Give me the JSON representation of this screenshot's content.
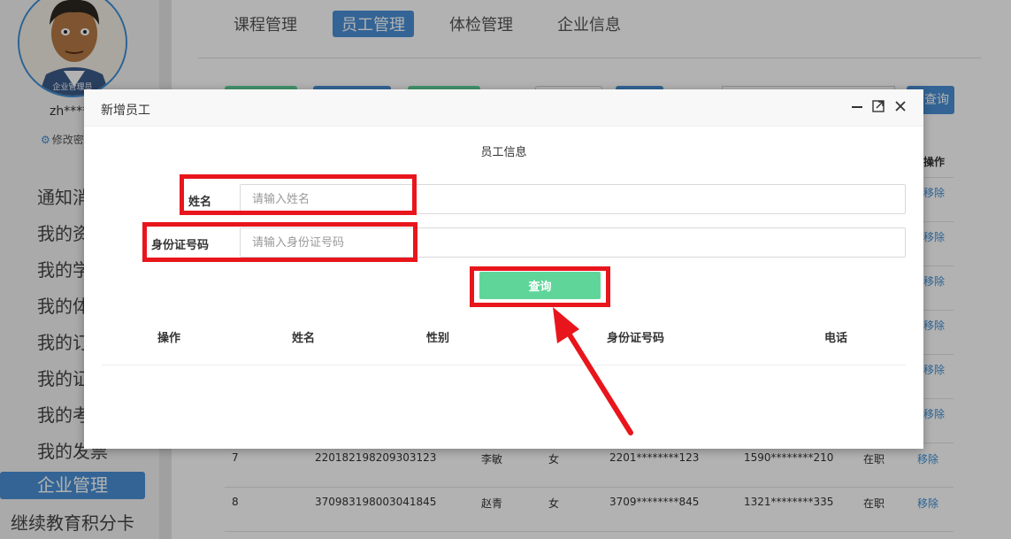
{
  "sidebar": {
    "avatar_badge": "企业管理员",
    "username": "zh****a",
    "change_password": "修改密",
    "menu": [
      "通知消",
      "我的资",
      "我的学",
      "我的体",
      "我的订",
      "我的证",
      "我的考",
      "我的发票",
      "企业管理",
      "继续教育积分卡"
    ],
    "active_menu": "企业管理"
  },
  "header": {
    "tabs": [
      "课程管理",
      "员工管理",
      "体检管理",
      "企业信息"
    ],
    "active_tab": "员工管理",
    "query_label": "查询"
  },
  "bg_table": {
    "op_header": "操作",
    "remove_label": "移除",
    "rows": [
      {
        "no": "7",
        "id": "220182198209303123",
        "name": "李敏",
        "gender": "女",
        "id_mask": "2201********123",
        "phone": "1590********210",
        "status": "在职",
        "action": "移除"
      },
      {
        "no": "8",
        "id": "370983198003041845",
        "name": "赵青",
        "gender": "女",
        "id_mask": "3709********845",
        "phone": "1321********335",
        "status": "在职",
        "action": "移除"
      }
    ]
  },
  "modal": {
    "title": "新增员工",
    "section_title": "员工信息",
    "name_label": "姓名",
    "name_placeholder": "请输入姓名",
    "idcard_label": "身份证号码",
    "idcard_placeholder": "请输入身份证号码",
    "query_button": "查询",
    "columns": [
      "操作",
      "姓名",
      "性别",
      "身份证号码",
      "电话"
    ]
  },
  "colors": {
    "accent": "#4a90d6",
    "submit": "#5fd59a",
    "annotation": "#e8161c"
  },
  "icons": [
    "minimize-icon",
    "maximize-icon",
    "close-icon",
    "gear-icon"
  ]
}
